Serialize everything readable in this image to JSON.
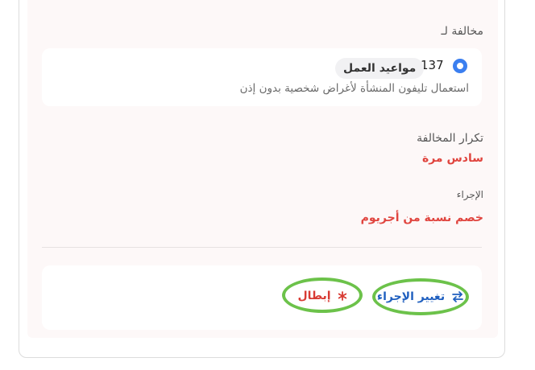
{
  "violation_section": {
    "label": "مخالفة لـ",
    "selected_code": "137",
    "category_chip": "مواعيد العمل",
    "description": "استعمال تليفون المنشأة لأغراض شخصية بدون إذن"
  },
  "repetition": {
    "label": "تكرار المخالفة",
    "value": "سادس مرة"
  },
  "action": {
    "label": "الإجراء",
    "value": "خصم نسبة من أجريوم"
  },
  "buttons": {
    "change_action": "تغيير الإجراء",
    "cancel": "إبطال"
  },
  "icons": {
    "change_action": "swap-arrows-icon",
    "cancel": "asterisk-icon"
  },
  "colors": {
    "accent_blue": "#1f5fbf",
    "danger_red": "#e0453f",
    "highlight_green": "#6cc24a"
  }
}
